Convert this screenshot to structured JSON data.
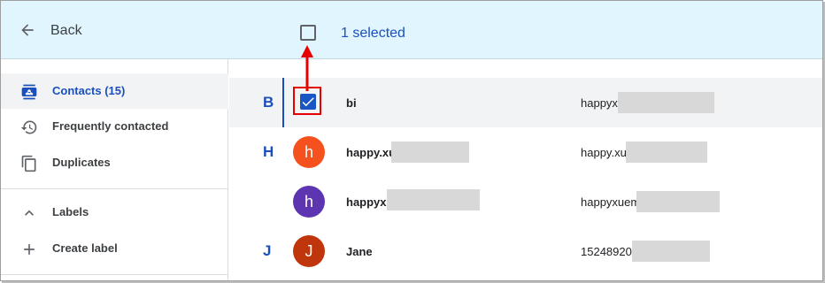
{
  "header": {
    "back_label": "Back",
    "selected_text": "1 selected"
  },
  "sidebar": {
    "items": [
      {
        "label": "Contacts (15)",
        "icon": "contacts-icon",
        "active": true
      },
      {
        "label": "Frequently contacted",
        "icon": "history-icon",
        "active": false
      },
      {
        "label": "Duplicates",
        "icon": "copy-icon",
        "active": false
      },
      {
        "label": "Labels",
        "icon": "chevron-up-icon",
        "active": false
      },
      {
        "label": "Create label",
        "icon": "plus-icon",
        "active": false
      }
    ]
  },
  "contacts": [
    {
      "letter": "B",
      "name": "bi",
      "email": "happyx",
      "selected": true,
      "avatar_letter": ""
    },
    {
      "letter": "H",
      "name": "happy.xu",
      "email": "happy.xu",
      "selected": false,
      "avatar_letter": "h",
      "avatar_color": "#f4511e"
    },
    {
      "letter": "",
      "name": "happyxu",
      "email": "happyxuem",
      "selected": false,
      "avatar_letter": "h",
      "avatar_color": "#5e35b1"
    },
    {
      "letter": "J",
      "name": "Jane",
      "email": "15248920",
      "selected": false,
      "avatar_letter": "J",
      "avatar_color": "#bf360c"
    }
  ],
  "colors": {
    "accent": "#1a4fbd",
    "topbar_bg": "#e1f5fe",
    "annotation": "#e60000"
  }
}
